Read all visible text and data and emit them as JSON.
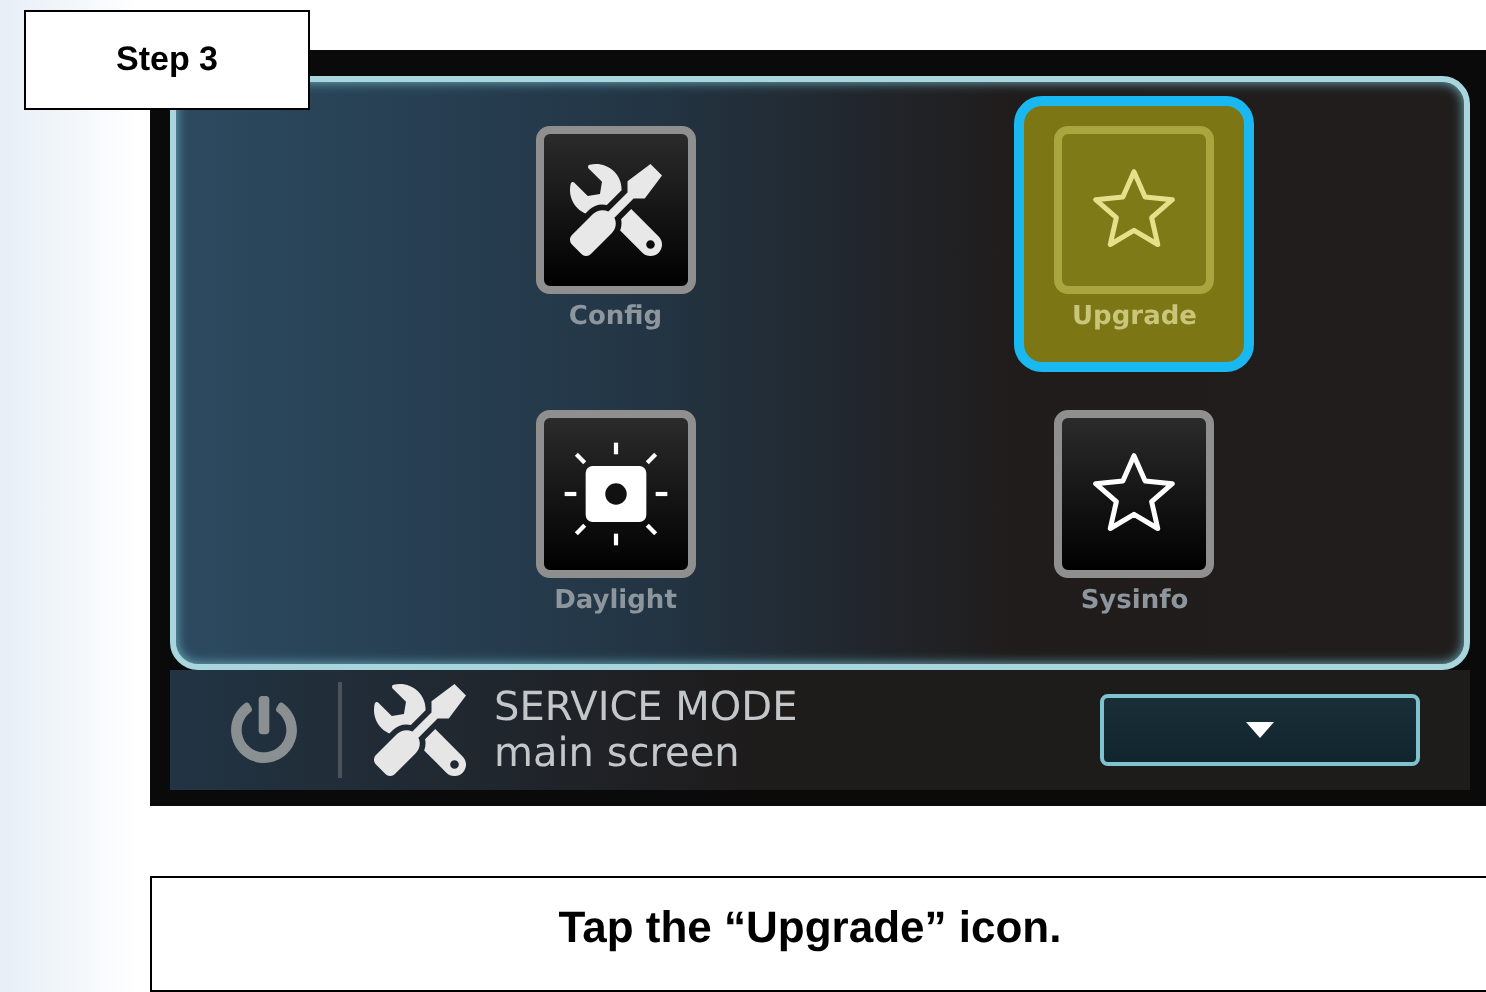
{
  "step_label": "Step 3",
  "tiles": [
    {
      "label": "Config",
      "kind": "tools",
      "selected": false
    },
    {
      "label": "Upgrade",
      "kind": "star",
      "selected": true
    },
    {
      "label": "Daylight",
      "kind": "daylight",
      "selected": false
    },
    {
      "label": "Sysinfo",
      "kind": "star",
      "selected": false
    }
  ],
  "status_bar": {
    "title": "SERVICE MODE",
    "subtitle": "main screen"
  },
  "instruction": "Tap the “Upgrade” icon."
}
